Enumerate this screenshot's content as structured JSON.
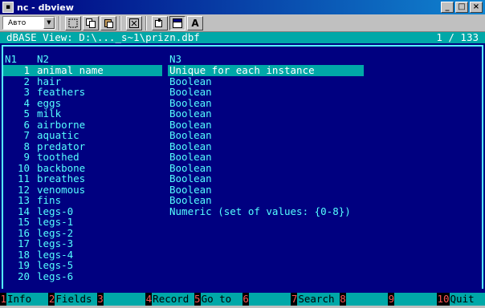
{
  "window": {
    "title": "nc - dbview",
    "buttons": [
      "_",
      "□",
      "×"
    ]
  },
  "toolbar": {
    "font_value": "Авто",
    "font_dropdown": "▼",
    "font_button": "A"
  },
  "view": {
    "path": "dBASE View: D:\\..._s~1\\prizn.dbf",
    "position": "1 / 133"
  },
  "columns": {
    "n1": "N1",
    "n2": "N2",
    "n3": "N3"
  },
  "rows": [
    {
      "num": "1",
      "name": "animal name",
      "type": "Unique for each instance",
      "selected": true
    },
    {
      "num": "2",
      "name": "hair",
      "type": "Boolean"
    },
    {
      "num": "3",
      "name": "feathers",
      "type": "Boolean"
    },
    {
      "num": "4",
      "name": "eggs",
      "type": "Boolean"
    },
    {
      "num": "5",
      "name": "milk",
      "type": "Boolean"
    },
    {
      "num": "6",
      "name": "airborne",
      "type": "Boolean"
    },
    {
      "num": "7",
      "name": "aquatic",
      "type": "Boolean"
    },
    {
      "num": "8",
      "name": "predator",
      "type": "Boolean"
    },
    {
      "num": "9",
      "name": "toothed",
      "type": "Boolean"
    },
    {
      "num": "10",
      "name": "backbone",
      "type": "Boolean"
    },
    {
      "num": "11",
      "name": "breathes",
      "type": "Boolean"
    },
    {
      "num": "12",
      "name": "venomous",
      "type": "Boolean"
    },
    {
      "num": "13",
      "name": "fins",
      "type": "Boolean"
    },
    {
      "num": "14",
      "name": "legs-0",
      "type": "Numeric (set of values: {0-8})"
    },
    {
      "num": "15",
      "name": "legs-1",
      "type": ""
    },
    {
      "num": "16",
      "name": "legs-2",
      "type": ""
    },
    {
      "num": "17",
      "name": "legs-3",
      "type": ""
    },
    {
      "num": "18",
      "name": "legs-4",
      "type": ""
    },
    {
      "num": "19",
      "name": "legs-5",
      "type": ""
    },
    {
      "num": "20",
      "name": "legs-6",
      "type": ""
    }
  ],
  "fkeys": [
    {
      "key": "1",
      "label": "Info"
    },
    {
      "key": "2",
      "label": "Fields"
    },
    {
      "key": "3",
      "label": ""
    },
    {
      "key": "4",
      "label": "Record"
    },
    {
      "key": "5",
      "label": "Go to"
    },
    {
      "key": "6",
      "label": ""
    },
    {
      "key": "7",
      "label": "Search"
    },
    {
      "key": "8",
      "label": ""
    },
    {
      "key": "9",
      "label": ""
    },
    {
      "key": "10",
      "label": "Quit"
    }
  ],
  "colors": {
    "background": "#000080",
    "text": "#55ffff",
    "highlight": "#00a8a8",
    "fkey_number": "#ff5555"
  }
}
